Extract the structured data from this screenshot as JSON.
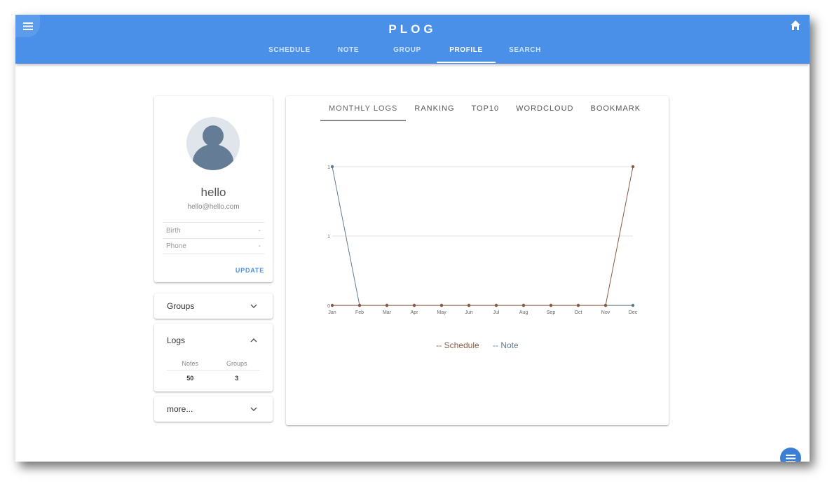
{
  "app": {
    "brand": "PLOG"
  },
  "nav": {
    "tabs": [
      "SCHEDULE",
      "NOTE",
      "GROUP",
      "PROFILE",
      "SEARCH"
    ],
    "active_index": 3
  },
  "profile": {
    "name": "hello",
    "email": "hello@hello.com",
    "birth_label": "Birth",
    "birth_value": "-",
    "phone_label": "Phone",
    "phone_value": "-",
    "update_label": "UPDATE"
  },
  "panels": {
    "groups_label": "Groups",
    "logs_label": "Logs",
    "more_label": "more...",
    "logs_table": {
      "headers": [
        "Notes",
        "Groups"
      ],
      "values": [
        "50",
        "3"
      ]
    }
  },
  "chart_tabs": [
    "MONTHLY LOGS",
    "RANKING",
    "TOP10",
    "WORDCLOUD",
    "BOOKMARK"
  ],
  "colors": {
    "appbar": "#4a90e8",
    "schedule": "#8a5a44",
    "note": "#607d8b"
  },
  "icons": {
    "menu": "menu-icon",
    "home": "home-icon",
    "fab": "menu-icon"
  },
  "chart_data": {
    "type": "line",
    "x": [
      "Jan",
      "Feb",
      "Mar",
      "Apr",
      "May",
      "Jun",
      "Jul",
      "Aug",
      "Sep",
      "Oct",
      "Nov",
      "Dec"
    ],
    "y_ticks": [
      "0",
      "1",
      "1"
    ],
    "ylim": [
      0,
      1
    ],
    "grid": true,
    "legend_position": "bottom",
    "series": [
      {
        "name": "Schedule",
        "values": [
          0,
          0,
          0,
          0,
          0,
          0,
          0,
          0,
          0,
          0,
          0,
          1
        ],
        "color": "#8a5a44"
      },
      {
        "name": "Note",
        "values": [
          1,
          0,
          0,
          0,
          0,
          0,
          0,
          0,
          0,
          0,
          0,
          0
        ],
        "color": "#607d8b"
      }
    ]
  }
}
